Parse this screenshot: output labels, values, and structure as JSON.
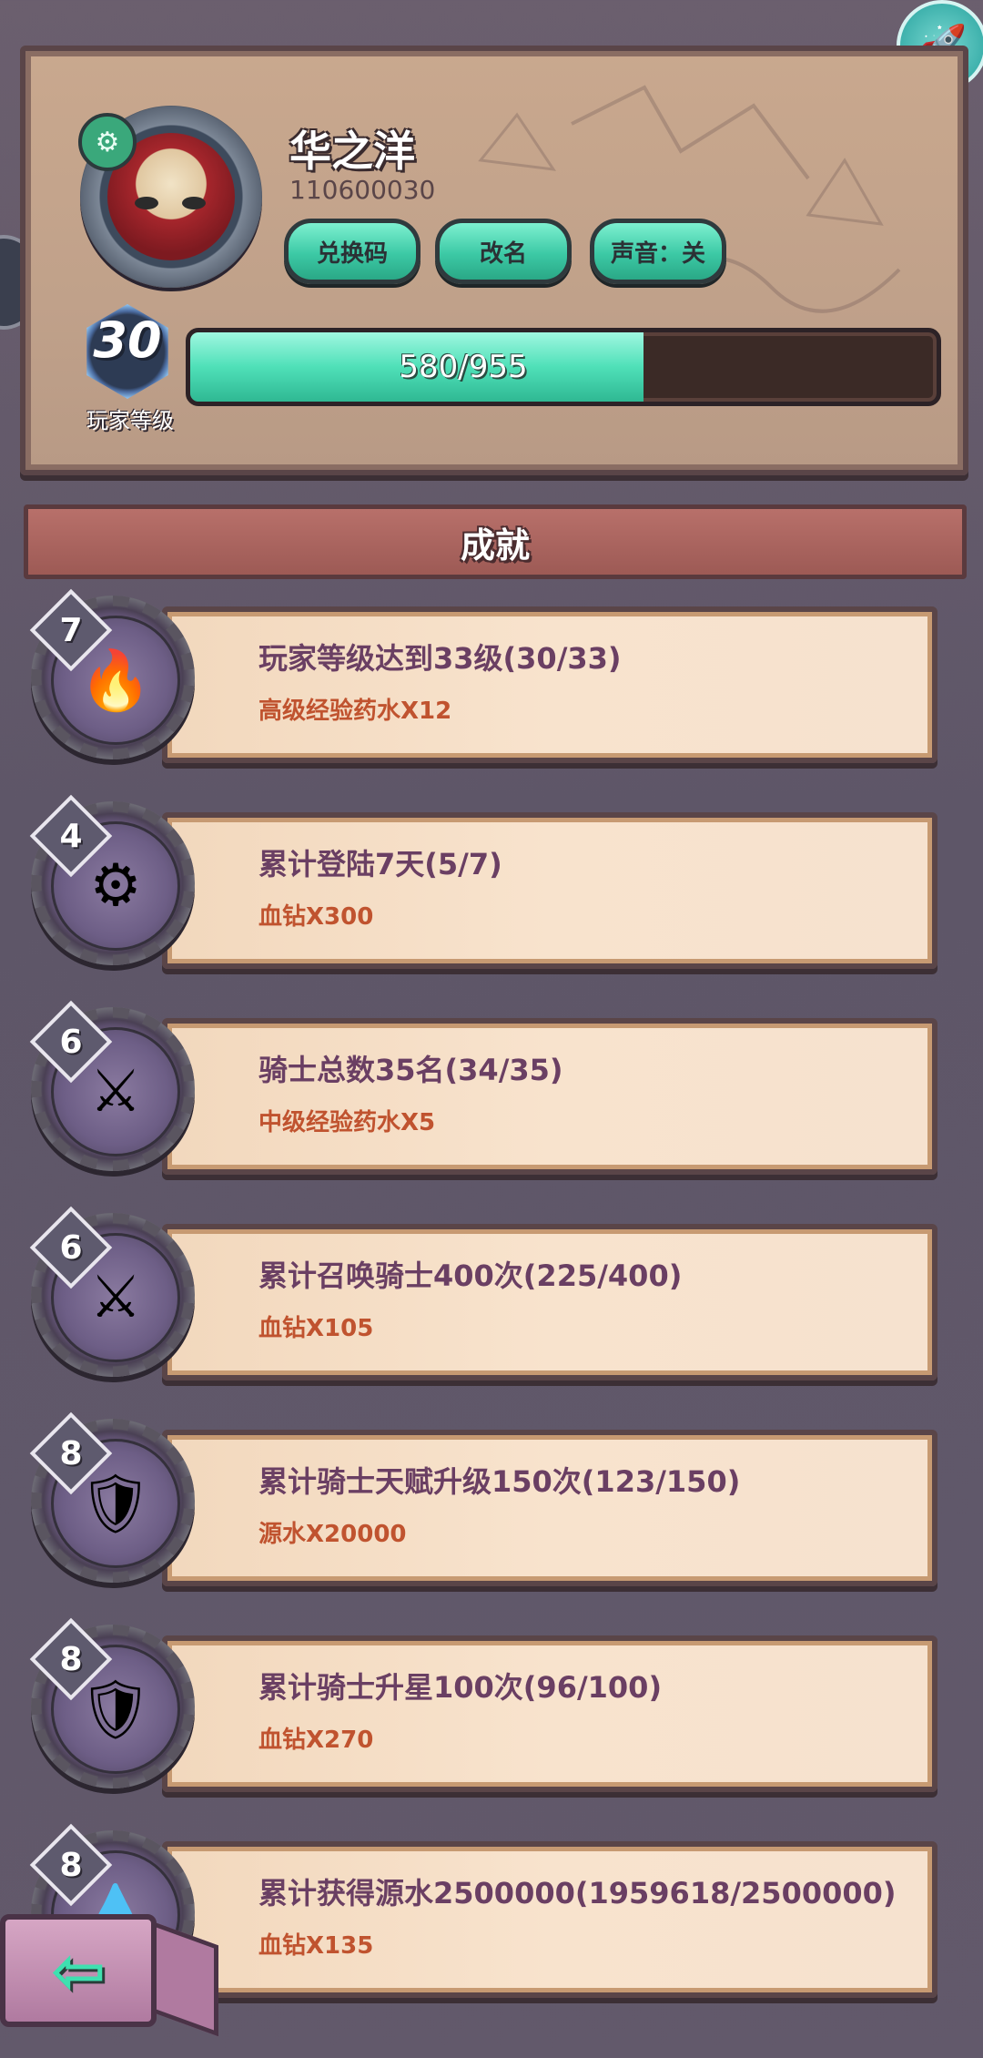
{
  "profile": {
    "username": "华之洋",
    "user_id": "110600030",
    "buttons": {
      "redeem_code": "兑换码",
      "rename": "改名",
      "sound": "声音：关"
    },
    "level": "30",
    "level_label": "玩家等级",
    "xp_text": "580/955",
    "xp_fraction": 0.607
  },
  "section": {
    "title": "成就"
  },
  "achievements": [
    {
      "badge": "7",
      "icon": "blue-flame-icon",
      "title": "玩家等级达到33级(30/33)",
      "reward": "高级经验药水X12"
    },
    {
      "badge": "4",
      "icon": "gear-crown-icon",
      "title": "累计登陆7天(5/7)",
      "reward": "血钻X300"
    },
    {
      "badge": "6",
      "icon": "knights-group-icon",
      "title": "骑士总数35名(34/35)",
      "reward": "中级经验药水X5"
    },
    {
      "badge": "6",
      "icon": "knights-group-icon",
      "title": "累计召唤骑士400次(225/400)",
      "reward": "血钻X105"
    },
    {
      "badge": "8",
      "icon": "knight-hat-icon",
      "title": "累计骑士天赋升级150次(123/150)",
      "reward": "源水X20000"
    },
    {
      "badge": "8",
      "icon": "knight-hat-icon",
      "title": "累计骑士升星100次(96/100)",
      "reward": "血钻X270"
    },
    {
      "badge": "8",
      "icon": "source-water-icon",
      "title": "累计获得源水2500000(1959618/2500000)",
      "reward": "血钻X135"
    }
  ],
  "colors": {
    "accent_teal": "#3cc9a5",
    "title_purple": "#6a3f63",
    "reward_orange": "#c0532f"
  }
}
